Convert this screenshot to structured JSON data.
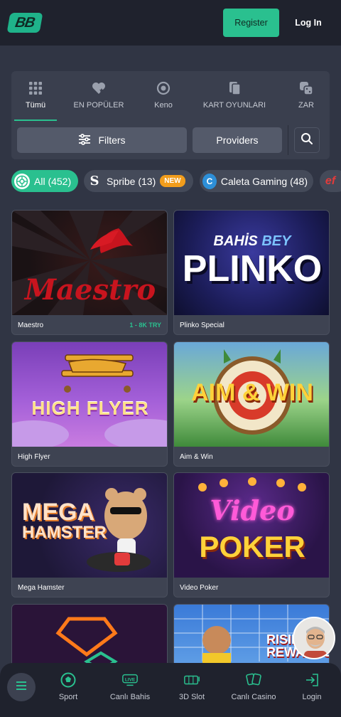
{
  "header": {
    "logo": "BB",
    "register_label": "Register",
    "login_label": "Log In"
  },
  "categories": [
    {
      "label": "Tümü",
      "icon": "grid-icon",
      "active": true
    },
    {
      "label": "EN POPÜLER",
      "icon": "heart-star-icon",
      "active": false
    },
    {
      "label": "Keno",
      "icon": "ball-icon",
      "active": false
    },
    {
      "label": "KART OYUNLARI",
      "icon": "cards-icon",
      "active": false
    },
    {
      "label": "ZAR",
      "icon": "dice-icon",
      "active": false
    }
  ],
  "filters": {
    "filters_label": "Filters",
    "providers_label": "Providers"
  },
  "chips": [
    {
      "label": "All (452)",
      "icon": "all-icon"
    },
    {
      "label": "Spribe (13)",
      "icon": "spribe-icon",
      "badge": "NEW"
    },
    {
      "label": "Caleta Gaming (48)",
      "icon": "caleta-icon"
    },
    {
      "label": "",
      "icon": "ef-icon"
    }
  ],
  "games": [
    {
      "title": "Maestro",
      "limit": "1 - 8K TRY",
      "art": "Maestro"
    },
    {
      "title": "Plinko Special",
      "limit": "",
      "art_top": "BAHİS",
      "art_top2": "BEY",
      "art": "PLINKO"
    },
    {
      "title": "High Flyer",
      "limit": "",
      "art": "HIGH FLYER"
    },
    {
      "title": "Aim & Win",
      "limit": "",
      "art": "AIM & WIN"
    },
    {
      "title": "Mega Hamster",
      "limit": "",
      "art": "MEGA",
      "art2": "HAMSTER"
    },
    {
      "title": "Video Poker",
      "limit": "",
      "art": "Video",
      "art2": "POKER"
    },
    {
      "title": "",
      "limit": "",
      "art": ""
    },
    {
      "title": "",
      "limit": "",
      "art": "RISING",
      "art2": "REWARDS"
    }
  ],
  "bottom_nav": [
    {
      "label": "Sport",
      "icon": "soccer-ball-icon"
    },
    {
      "label": "Canlı Bahis",
      "icon": "live-icon",
      "badge": "LIVE"
    },
    {
      "label": "3D Slot",
      "icon": "3d-slot-icon"
    },
    {
      "label": "Canlı Casino",
      "icon": "live-casino-icon"
    },
    {
      "label": "Login",
      "icon": "login-icon"
    }
  ],
  "colors": {
    "accent": "#2ac08f",
    "background": "#303544",
    "header": "#1f222d",
    "new_badge": "#f29d1c"
  }
}
